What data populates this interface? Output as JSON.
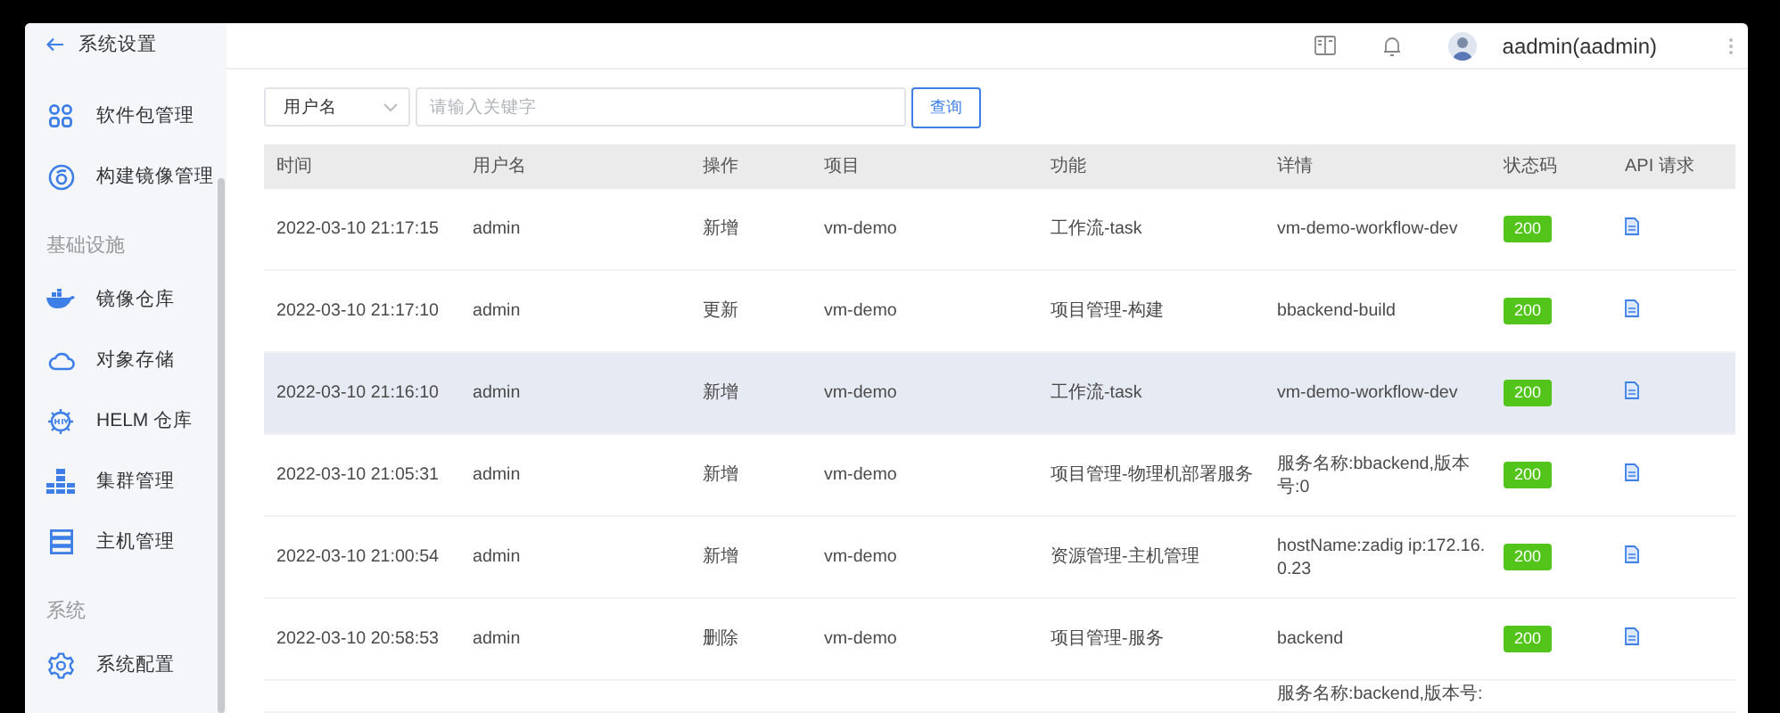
{
  "header": {
    "back_label": "系统设置",
    "user_name": "aadmin(aadmin)"
  },
  "sidebar": {
    "groups": [
      {
        "items": [
          {
            "kind": "package",
            "label": "软件包管理"
          },
          {
            "kind": "image",
            "label": "构建镜像管理"
          }
        ]
      },
      {
        "title": "基础设施",
        "items": [
          {
            "kind": "registry",
            "label": "镜像仓库"
          },
          {
            "kind": "cloud",
            "label": "对象存储"
          },
          {
            "kind": "helm",
            "label": "HELM 仓库"
          },
          {
            "kind": "cluster",
            "label": "集群管理"
          },
          {
            "kind": "host",
            "label": "主机管理"
          }
        ]
      },
      {
        "title": "系统",
        "items": [
          {
            "kind": "config",
            "label": "系统配置"
          }
        ]
      }
    ]
  },
  "search": {
    "field_select": "用户名",
    "placeholder": "请输入关键字",
    "button": "查询"
  },
  "table": {
    "columns": [
      "时间",
      "用户名",
      "操作",
      "项目",
      "功能",
      "详情",
      "状态码",
      "API 请求"
    ],
    "rows": [
      {
        "selected": false,
        "time": "2022-03-10 21:17:15",
        "user": "admin",
        "action": "新增",
        "project": "vm-demo",
        "function": "工作流-task",
        "detail": "vm-demo-workflow-dev",
        "status": "200"
      },
      {
        "selected": false,
        "time": "2022-03-10 21:17:10",
        "user": "admin",
        "action": "更新",
        "project": "vm-demo",
        "function": "项目管理-构建",
        "detail": "bbackend-build",
        "status": "200"
      },
      {
        "selected": true,
        "time": "2022-03-10 21:16:10",
        "user": "admin",
        "action": "新增",
        "project": "vm-demo",
        "function": "工作流-task",
        "detail": "vm-demo-workflow-dev",
        "status": "200"
      },
      {
        "selected": false,
        "time": "2022-03-10 21:05:31",
        "user": "admin",
        "action": "新增",
        "project": "vm-demo",
        "function": "项目管理-物理机部署服务",
        "detail": "服务名称:bbackend,版本号:0",
        "status": "200"
      },
      {
        "selected": false,
        "time": "2022-03-10 21:00:54",
        "user": "admin",
        "action": "新增",
        "project": "vm-demo",
        "function": "资源管理-主机管理",
        "detail": "hostName:zadig ip:172.16.0.23",
        "status": "200"
      },
      {
        "selected": false,
        "time": "2022-03-10 20:58:53",
        "user": "admin",
        "action": "删除",
        "project": "vm-demo",
        "function": "项目管理-服务",
        "detail": "backend",
        "status": "200"
      },
      {
        "selected": false,
        "detail": "服务名称:backend,版本号:"
      }
    ]
  }
}
